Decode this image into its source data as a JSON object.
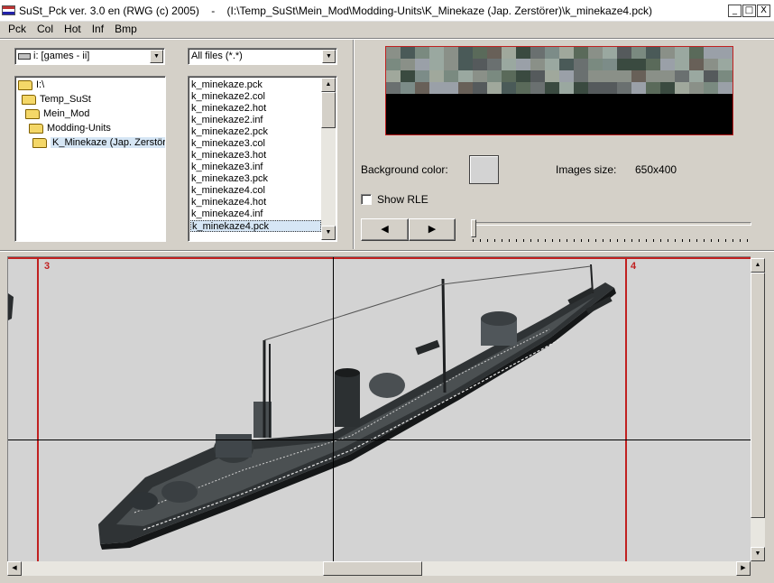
{
  "window": {
    "title": "SuSt_Pck ver. 3.0 en (RWG (c) 2005)    -    (I:\\Temp_SuSt\\Mein_Mod\\Modding-Units\\K_Minekaze (Jap. Zerstörer)\\k_minekaze4.pck)",
    "minimize": "_",
    "maximize": "□",
    "close": "X"
  },
  "menu": [
    "Pck",
    "Col",
    "Hot",
    "Inf",
    "Bmp"
  ],
  "drive_select": {
    "value": "i: [games - ii]"
  },
  "filter_select": {
    "value": "All files (*.*)"
  },
  "folder_tree": [
    {
      "label": "I:\\"
    },
    {
      "label": "Temp_SuSt"
    },
    {
      "label": "Mein_Mod"
    },
    {
      "label": "Modding-Units"
    },
    {
      "label": "K_Minekaze (Jap. Zerstöre",
      "selected": true
    }
  ],
  "file_list": [
    "k_minekaze.pck",
    "k_minekaze2.col",
    "k_minekaze2.hot",
    "k_minekaze2.inf",
    "k_minekaze2.pck",
    "k_minekaze3.col",
    "k_minekaze3.hot",
    "k_minekaze3.inf",
    "k_minekaze3.pck",
    "k_minekaze4.col",
    "k_minekaze4.hot",
    "k_minekaze4.inf",
    "k_minekaze4.pck"
  ],
  "file_list_selected_index": 12,
  "labels": {
    "background_color": "Background color:",
    "images_size_label": "Images size:",
    "images_size_value": "650x400",
    "show_rle": "Show RLE"
  },
  "controls": {
    "prev_button": "◀",
    "next_button": "▶",
    "show_rle_checked": false,
    "background_color": "#d3d3d3",
    "frame_slider_position": 0
  },
  "canvas": {
    "frame_left": "3",
    "frame_right": "4"
  },
  "icons": {
    "scroll_up": "▲",
    "scroll_down": "▼",
    "scroll_left": "◀",
    "scroll_right": "▶",
    "dropdown": "▼"
  },
  "colors": {
    "frame_red": "#c02020",
    "selection": "#d6e6f5",
    "canvas_bg": "#d3d3d3"
  }
}
